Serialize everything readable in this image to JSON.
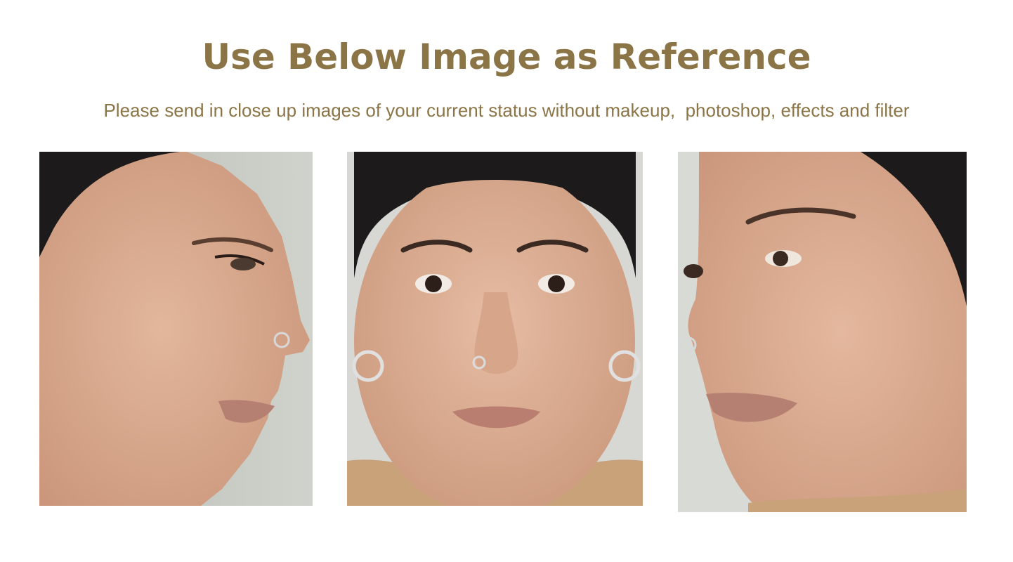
{
  "header": {
    "title": "Use Below Image as Reference",
    "subtitle": "Please send in close up images of your current status without makeup,  photoshop, effects and filter"
  },
  "reference_photos": [
    {
      "view": "left-profile"
    },
    {
      "view": "front"
    },
    {
      "view": "right-three-quarter"
    }
  ],
  "colors": {
    "accent": "#8b7547",
    "background": "#ffffff",
    "photo_backdrop": "#c9ccc4",
    "skin": "#d9a88c",
    "hair": "#1c1a1a",
    "sweater": "#c9a27a"
  }
}
